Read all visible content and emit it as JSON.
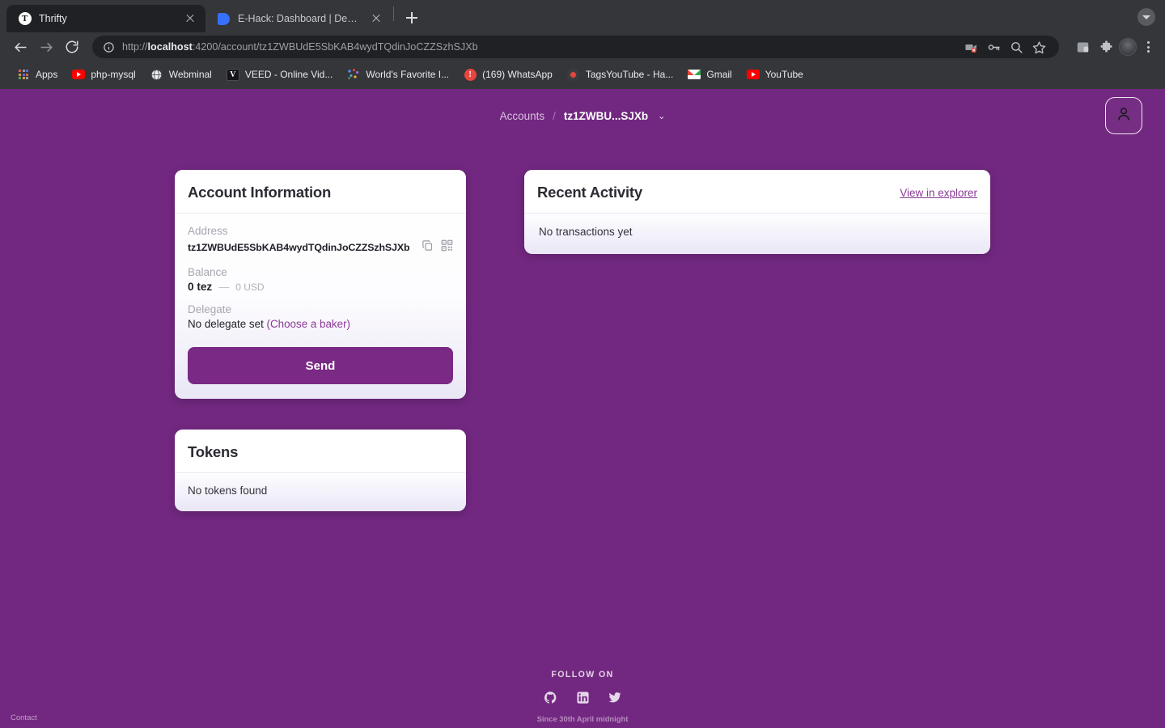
{
  "browser": {
    "tabs": [
      {
        "title": "Thrifty",
        "favicon": "thrifty-t-icon",
        "active": true
      },
      {
        "title": "E-Hack: Dashboard | Devfolio",
        "favicon": "devfolio-icon",
        "active": false
      }
    ],
    "new_tab_label": "+",
    "url_scheme": "http://",
    "url_host": "localhost",
    "url_rest": ":4200/account/tz1ZWBUdE5SbKAB4wydTQdinJoCZZSzhSJXb",
    "url_full": "http://localhost:4200/account/tz1ZWBUdE5SbKAB4wydTQdinJoCZZSzhSJXb",
    "toolbar_icons": [
      "camera-blocked-icon",
      "key-icon",
      "search-icon",
      "star-icon",
      "side-panel-icon",
      "extensions-puzzle-icon",
      "profile-avatar-icon",
      "kebab-menu-icon"
    ],
    "bookmarks": [
      {
        "label": "Apps",
        "icon": "apps-grid-icon"
      },
      {
        "label": "php-mysql",
        "icon": "youtube-icon"
      },
      {
        "label": "Webminal",
        "icon": "globe-icon"
      },
      {
        "label": "VEED - Online Vid...",
        "icon": "veed-icon"
      },
      {
        "label": "World's Favorite I...",
        "icon": "dots-cluster-icon"
      },
      {
        "label": "(169) WhatsApp",
        "icon": "exclamation-circle-icon"
      },
      {
        "label": "TagsYouTube - Ha...",
        "icon": "record-circle-icon"
      },
      {
        "label": "Gmail",
        "icon": "gmail-icon"
      },
      {
        "label": "YouTube",
        "icon": "youtube-icon"
      }
    ]
  },
  "page": {
    "breadcrumb": {
      "root": "Accounts",
      "separator": "/",
      "current": "tz1ZWBU...SJXb",
      "caret": "⌄"
    },
    "profile_button_icon": "person-icon",
    "account_card": {
      "title": "Account Information",
      "address_label": "Address",
      "address_value": "tz1ZWBUdE5SbKAB4wydTQdinJoCZZSzhSJXb",
      "copy_icon": "copy-icon",
      "qr_icon": "qr-code-icon",
      "balance_label": "Balance",
      "balance_value": "0 tez",
      "balance_dash": "—",
      "balance_usd": "0 USD",
      "delegate_label": "Delegate",
      "delegate_status": "No delegate set ",
      "delegate_link": "(Choose a baker)",
      "send_label": "Send"
    },
    "tokens_card": {
      "title": "Tokens",
      "empty": "No tokens found"
    },
    "activity_card": {
      "title": "Recent Activity",
      "link": "View in explorer",
      "empty": "No transactions yet"
    },
    "footer": {
      "follow_on": "FOLLOW ON",
      "socials": [
        "github-icon",
        "linkedin-icon",
        "twitter-icon"
      ],
      "since": "Since 30th April midnight",
      "contact": "Contact"
    }
  },
  "colors": {
    "page_background": "#722880",
    "accent_purple": "#8a3a96",
    "send_button": "#7a2a84",
    "chrome_bar": "#35363a",
    "chrome_tab_active": "#202124"
  }
}
